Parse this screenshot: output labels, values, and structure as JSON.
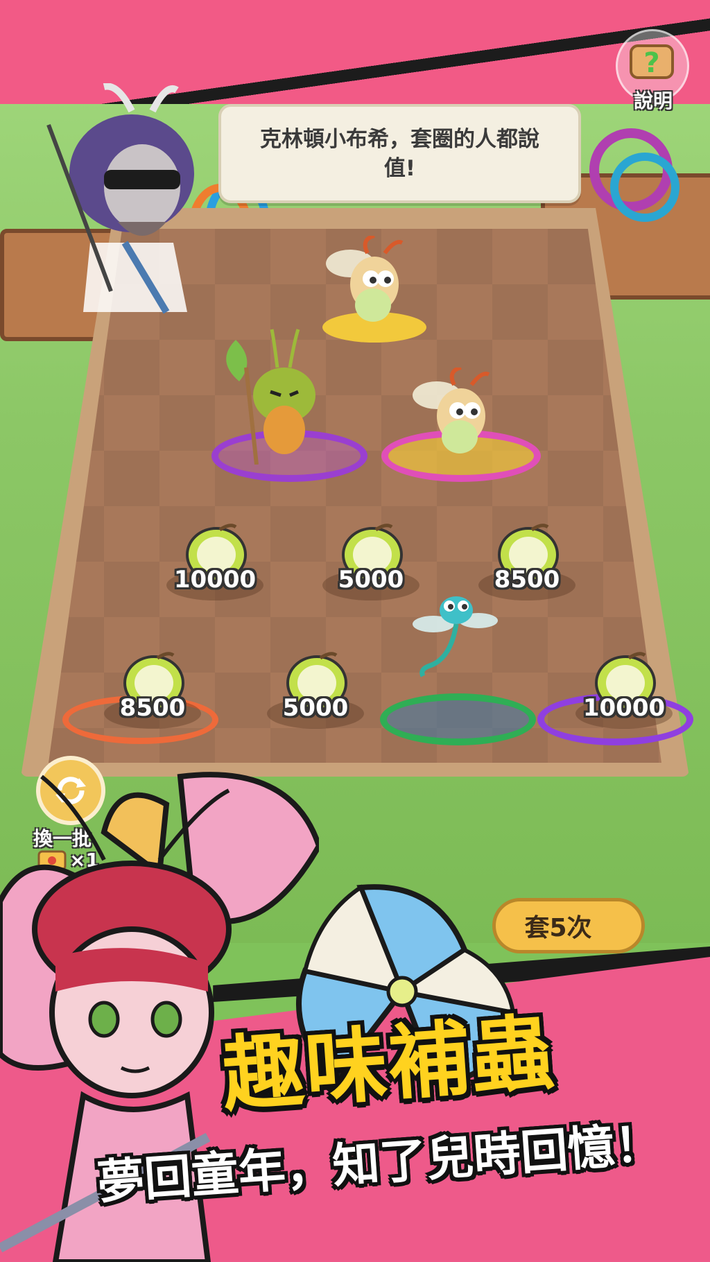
{
  "npc": {
    "dialogue": "克林頓小布希，套圈的人都說值!"
  },
  "help_button": {
    "label": "說明",
    "icon": "scroll-question-icon"
  },
  "slots": {
    "row1": [
      "10000",
      "5000",
      "8500"
    ],
    "row2": [
      "8500",
      "5000",
      "10000"
    ]
  },
  "swap_button": {
    "label": "換一批",
    "cost": "×1",
    "icon": "refresh-icon"
  },
  "throw_button": {
    "label": "套5次"
  },
  "promo": {
    "title": "趣味補蟲",
    "subtitle": "夢回童年，知了兒時回憶！"
  },
  "colors": {
    "ring_purple": "#9a3fd0",
    "ring_magenta": "#e04fb8",
    "ring_orange": "#ee6a3a",
    "ring_green": "#2fae55",
    "ring_violet": "#8f3fe0",
    "accent_pink": "#f25a86",
    "title_yellow": "#ffd21f"
  }
}
